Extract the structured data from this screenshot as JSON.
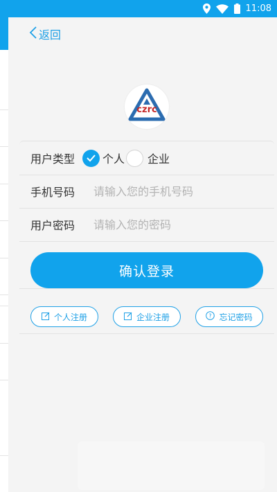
{
  "status_bar": {
    "time": "11:08",
    "icons": [
      "location-icon",
      "wifi-icon",
      "battery-icon"
    ],
    "background": "#11a3ec"
  },
  "header": {
    "back_label": "返回",
    "back_icon": "chevron-left-icon"
  },
  "logo": {
    "text": "czrc",
    "text_color": "#c62828",
    "triangle_color": "#2b6cb0"
  },
  "form": {
    "user_type": {
      "label": "用户类型",
      "options": [
        {
          "label": "个人",
          "checked": true
        },
        {
          "label": "企业",
          "checked": false
        }
      ]
    },
    "phone": {
      "label": "手机号码",
      "placeholder": "请输入您的手机号码",
      "value": ""
    },
    "password": {
      "label": "用户密码",
      "placeholder": "请输入您的密码",
      "value": ""
    }
  },
  "login_button": "确认登录",
  "links": [
    {
      "label": "个人注册",
      "icon": "edit-icon"
    },
    {
      "label": "企业注册",
      "icon": "edit-icon"
    },
    {
      "label": "忘记密码",
      "icon": "question-circle-icon"
    }
  ],
  "colors": {
    "accent": "#11a3ec",
    "link": "#1ea0e6",
    "background": "#f4f4f4"
  }
}
